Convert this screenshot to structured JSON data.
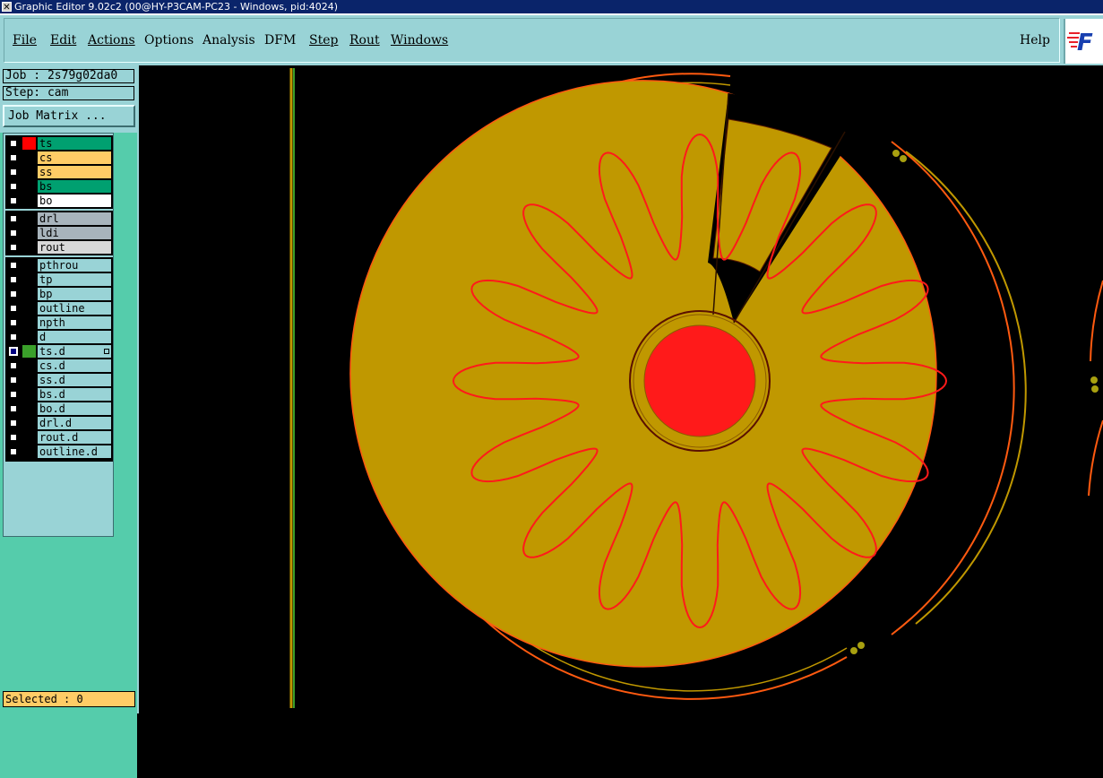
{
  "window": {
    "title": "Graphic Editor 9.02c2 (00@HY-P3CAM-PC23 - Windows, pid:4024)"
  },
  "menu": {
    "file": "File",
    "edit": "Edit",
    "actions": "Actions",
    "options": "Options",
    "analysis": "Analysis",
    "dfm": "DFM",
    "step": "Step",
    "rout": "Rout",
    "windows": "Windows",
    "help": "Help"
  },
  "logo": {
    "text": "F",
    "accent_color": "#e8202a",
    "brand_color": "#1840b0"
  },
  "panel": {
    "job": "Job : 2s79g02da0",
    "step": "Step: cam",
    "job_matrix": "Job Matrix ...",
    "selected": "Selected : 0"
  },
  "layers": [
    {
      "name": "ts",
      "color": "#00a070",
      "swatch": "#ff0000",
      "checked": false
    },
    {
      "name": "cs",
      "color": "#ffcc66",
      "swatch": "",
      "checked": false
    },
    {
      "name": "ss",
      "color": "#ffcc66",
      "swatch": "",
      "checked": false
    },
    {
      "name": "bs",
      "color": "#00a070",
      "swatch": "",
      "checked": false
    },
    {
      "name": "bo",
      "color": "#ffffff",
      "swatch": "",
      "checked": false
    },
    {
      "name": "drl",
      "color": "#a8b4bc",
      "swatch": "",
      "checked": false
    },
    {
      "name": "ldi",
      "color": "#a8b4bc",
      "swatch": "",
      "checked": false
    },
    {
      "name": "rout",
      "color": "#d8d8d8",
      "swatch": "",
      "checked": false
    },
    {
      "name": "pthrou",
      "color": "#99d3d6",
      "swatch": "",
      "checked": false
    },
    {
      "name": "tp",
      "color": "#99d3d6",
      "swatch": "",
      "checked": false
    },
    {
      "name": "bp",
      "color": "#99d3d6",
      "swatch": "",
      "checked": false
    },
    {
      "name": "outline",
      "color": "#99d3d6",
      "swatch": "",
      "checked": false
    },
    {
      "name": "npth",
      "color": "#99d3d6",
      "swatch": "",
      "checked": false
    },
    {
      "name": "d",
      "color": "#99d3d6",
      "swatch": "",
      "checked": false
    },
    {
      "name": "ts.d",
      "color": "#99d3d6",
      "swatch": "#3aa02a",
      "checked": true
    },
    {
      "name": "cs.d",
      "color": "#99d3d6",
      "swatch": "",
      "checked": false
    },
    {
      "name": "ss.d",
      "color": "#99d3d6",
      "swatch": "",
      "checked": false
    },
    {
      "name": "bs.d",
      "color": "#99d3d6",
      "swatch": "",
      "checked": false
    },
    {
      "name": "bo.d",
      "color": "#99d3d6",
      "swatch": "",
      "checked": false
    },
    {
      "name": "drl.d",
      "color": "#99d3d6",
      "swatch": "",
      "checked": false
    },
    {
      "name": "rout.d",
      "color": "#99d3d6",
      "swatch": "",
      "checked": false
    },
    {
      "name": "outline.d",
      "color": "#99d3d6",
      "swatch": "",
      "checked": false
    }
  ],
  "canvas": {
    "copper_color": "#c09800",
    "outline_color": "#ff3010",
    "pad_color": "#ff0000",
    "ring_color": "#b08a00"
  }
}
